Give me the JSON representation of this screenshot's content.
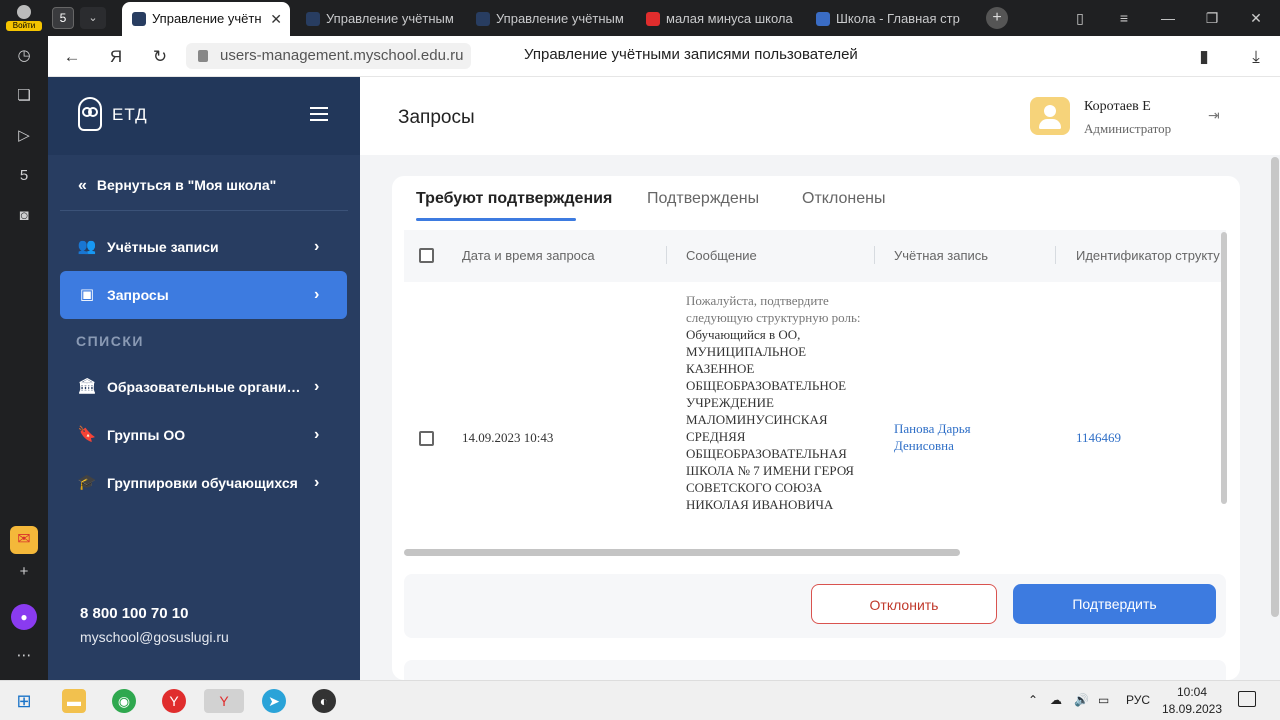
{
  "browser": {
    "login_label": "Войти",
    "tab_count": "5",
    "tabs": [
      {
        "title": "Управление учётн",
        "active": true,
        "favicon_color": "#283d61"
      },
      {
        "title": "Управление учётным",
        "active": false,
        "favicon_color": "#283d61"
      },
      {
        "title": "Управление учётным",
        "active": false,
        "favicon_color": "#283d61"
      },
      {
        "title": "малая минуса школа",
        "active": false,
        "favicon_color": "#e02d2d"
      },
      {
        "title": "Школа - Главная стр",
        "active": false,
        "favicon_color": "#3a6cc4"
      }
    ],
    "url": "users-management.myschool.edu.ru",
    "page_title": "Управление учётными записями пользователей"
  },
  "sidebar": {
    "logo_text": "ЕТД",
    "back_label": "Вернуться в \"Моя школа\"",
    "items": [
      {
        "label": "Учётные записи",
        "icon": "people-icon"
      },
      {
        "label": "Запросы",
        "icon": "inbox-icon",
        "active": true
      }
    ],
    "section_title": "СПИСКИ",
    "list_items": [
      {
        "label": "Образовательные организа...",
        "icon": "bank-icon"
      },
      {
        "label": "Группы ОО",
        "icon": "bookmark-icon"
      },
      {
        "label": "Группировки обучающихся",
        "icon": "graduation-cap-icon"
      }
    ],
    "phone": "8 800 100 70 10",
    "email": "myschool@gosuslugi.ru"
  },
  "header": {
    "title": "Запросы",
    "user_name": "Коротаев Е",
    "user_role": "Администратор"
  },
  "requests": {
    "tabs": [
      "Требуют подтверждения",
      "Подтверждены",
      "Отклонены"
    ],
    "columns": [
      "Дата и время запроса",
      "Сообщение",
      "Учётная запись",
      "Идентификатор структу"
    ],
    "row": {
      "datetime": "14.09.2023 10:43",
      "message_intro": "Пожалуйста, подтвердите следующую структурную роль:",
      "message_body": "Обучающийся в ОО, МУНИЦИПАЛЬНОЕ КАЗЕННОЕ ОБЩЕОБРАЗОВАТЕЛЬНОЕ УЧРЕЖДЕНИЕ МАЛОМИНУСИНСКАЯ СРЕДНЯЯ ОБЩЕОБРАЗОВАТЕЛЬНАЯ ШКОЛА № 7 ИМЕНИ ГЕРОЯ СОВЕТСКОГО СОЮЗА НИКОЛАЯ ИВАНОВИЧА",
      "account": "Панова Дарья Денисовна",
      "identifier": "1146469"
    },
    "reject_label": "Отклонить",
    "confirm_label": "Подтвердить"
  },
  "taskbar": {
    "language": "РУС",
    "time": "10:04",
    "date": "18.09.2023"
  },
  "colors": {
    "sidebar_bg": "#283d61",
    "accent": "#3d7be0",
    "reject": "#d9534f",
    "link": "#2f6fc7"
  }
}
